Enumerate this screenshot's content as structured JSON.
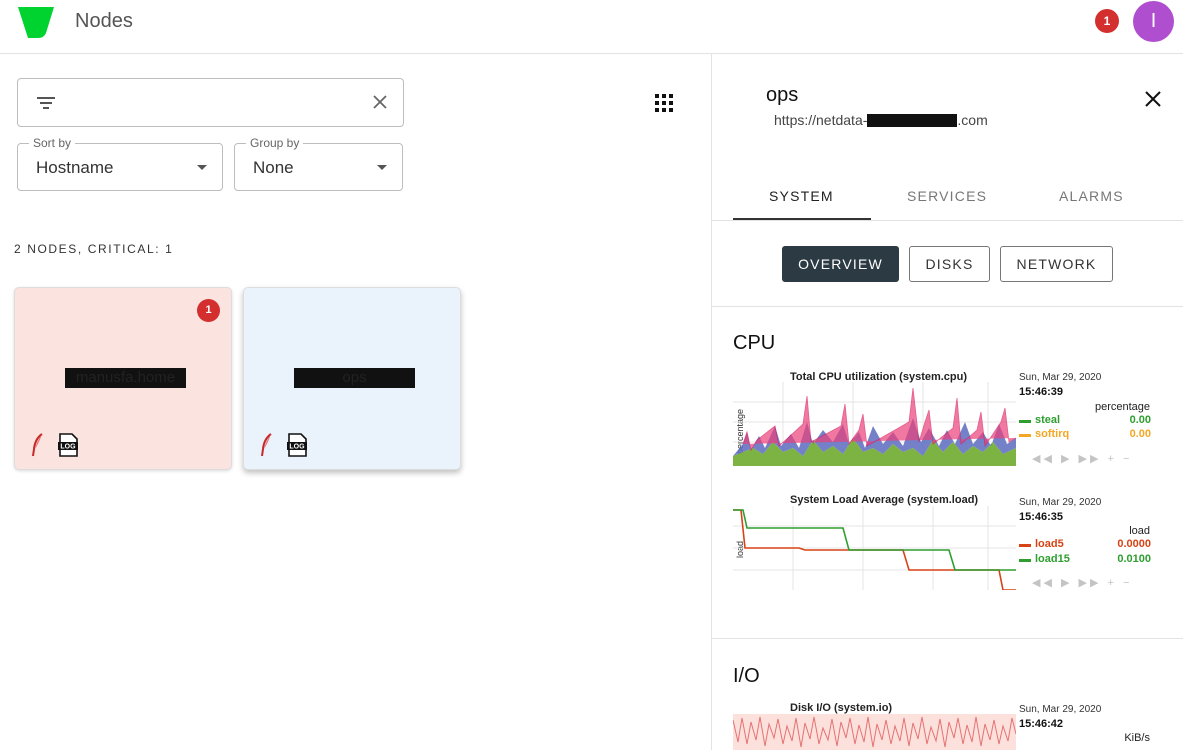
{
  "header": {
    "title": "Nodes",
    "notification_count": "1",
    "avatar_initial": "I",
    "brand_color": "#00d32f"
  },
  "filters": {
    "sort": {
      "label": "Sort by",
      "value": "Hostname"
    },
    "group": {
      "label": "Group by",
      "value": "None"
    }
  },
  "summary": "2 NODES, CRITICAL: 1",
  "nodes": [
    {
      "name": "manusfa.home",
      "status": "critical",
      "alarm_count": "1",
      "icons": [
        "feather-icon",
        "log-icon"
      ]
    },
    {
      "name": "ops",
      "status": "normal",
      "icons": [
        "feather-icon",
        "log-icon"
      ]
    }
  ],
  "detail": {
    "title": "ops",
    "url_prefix": "https://netdata-",
    "url_suffix": ".com",
    "tabs": [
      "SYSTEM",
      "SERVICES",
      "ALARMS"
    ],
    "subtabs": [
      "OVERVIEW",
      "DISKS",
      "NETWORK"
    ],
    "sections": [
      {
        "title": "CPU",
        "charts": [
          {
            "title": "Total CPU utilization (system.cpu)",
            "ylabel": "percentage",
            "date": "Sun, Mar 29, 2020",
            "time": "15:46:39",
            "units": "percentage",
            "legend": [
              {
                "name": "steal",
                "value": "0.00",
                "color": "#2e9e2e"
              },
              {
                "name": "softirq",
                "value": "0.00",
                "color": "#f5a623"
              }
            ]
          },
          {
            "title": "System Load Average (system.load)",
            "ylabel": "load",
            "date": "Sun, Mar 29, 2020",
            "time": "15:46:35",
            "units": "load",
            "legend": [
              {
                "name": "load5",
                "value": "0.0000",
                "color": "#d84315"
              },
              {
                "name": "load15",
                "value": "0.0100",
                "color": "#2e9e2e"
              }
            ]
          }
        ]
      },
      {
        "title": "I/O",
        "charts": [
          {
            "title": "Disk I/O (system.io)",
            "date": "Sun, Mar 29, 2020",
            "time": "15:46:42",
            "units": "KiB/s"
          }
        ]
      }
    ]
  }
}
